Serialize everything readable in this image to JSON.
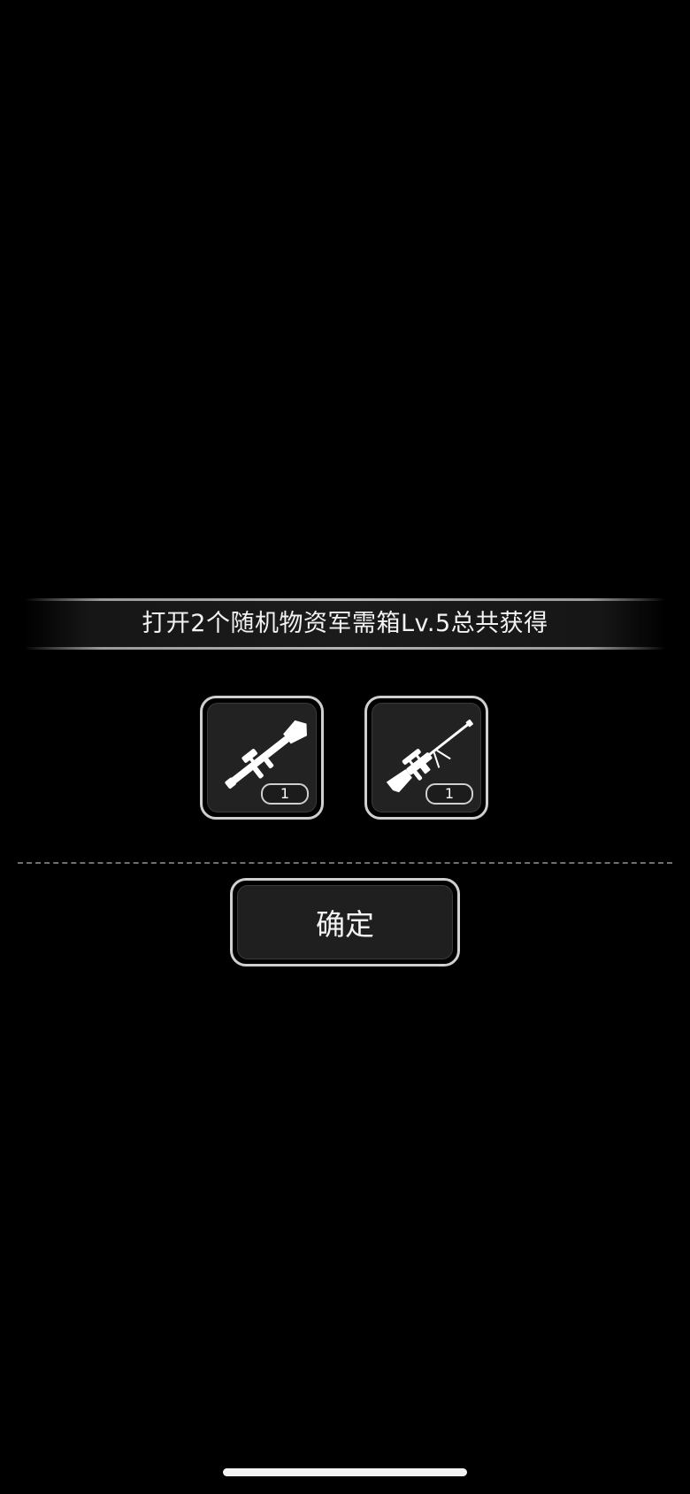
{
  "banner": {
    "text": "打开2个随机物资军需箱Lv.5总共获得"
  },
  "rewards": [
    {
      "icon": "rocket-launcher-icon",
      "count": "1"
    },
    {
      "icon": "sniper-rifle-icon",
      "count": "1"
    }
  ],
  "confirm": {
    "label": "确定"
  },
  "colors": {
    "background": "#000000",
    "frame": "#cfcfcf",
    "slot_fill": "#222222"
  }
}
